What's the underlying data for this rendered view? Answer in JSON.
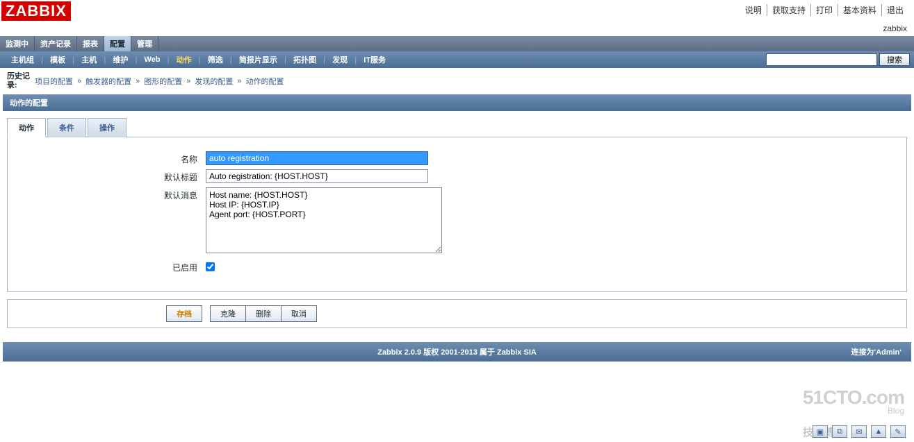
{
  "logo": "ZABBIX",
  "top_links": [
    "说明",
    "获取支持",
    "打印",
    "基本资料",
    "退出"
  ],
  "user_label": "zabbix",
  "main_menu": {
    "items": [
      "监测中",
      "资产记录",
      "报表",
      "配置",
      "管理"
    ],
    "active_index": 3
  },
  "sub_menu": {
    "items": [
      "主机组",
      "模板",
      "主机",
      "维护",
      "Web",
      "动作",
      "筛选",
      "简报片显示",
      "拓扑图",
      "发现",
      "IT服务"
    ],
    "active_index": 5
  },
  "search": {
    "placeholder": "",
    "button": "搜索"
  },
  "history": {
    "label": "历史记录:",
    "items": [
      "项目的配置",
      "触发器的配置",
      "图形的配置",
      "发现的配置",
      "动作的配置"
    ]
  },
  "section_title": "动作的配置",
  "tabs": {
    "items": [
      "动作",
      "条件",
      "操作"
    ],
    "active_index": 0
  },
  "form": {
    "name_label": "名称",
    "name_value": "auto registration",
    "subject_label": "默认标题",
    "subject_value": "Auto registration: {HOST.HOST}",
    "message_label": "默认消息",
    "message_value": "Host name: {HOST.HOST}\nHost IP: {HOST.IP}\nAgent port: {HOST.PORT}",
    "enabled_label": "已启用",
    "enabled": true
  },
  "buttons": {
    "save": "存档",
    "clone": "克隆",
    "delete": "删除",
    "cancel": "取消"
  },
  "footer": {
    "text": "Zabbix 2.0.9 版权 2001-2013 属于 Zabbix SIA",
    "right": "连接为'Admin'"
  },
  "watermark": {
    "main": "51CTO.com",
    "sub": "Blog",
    "cn": "技术博客"
  }
}
